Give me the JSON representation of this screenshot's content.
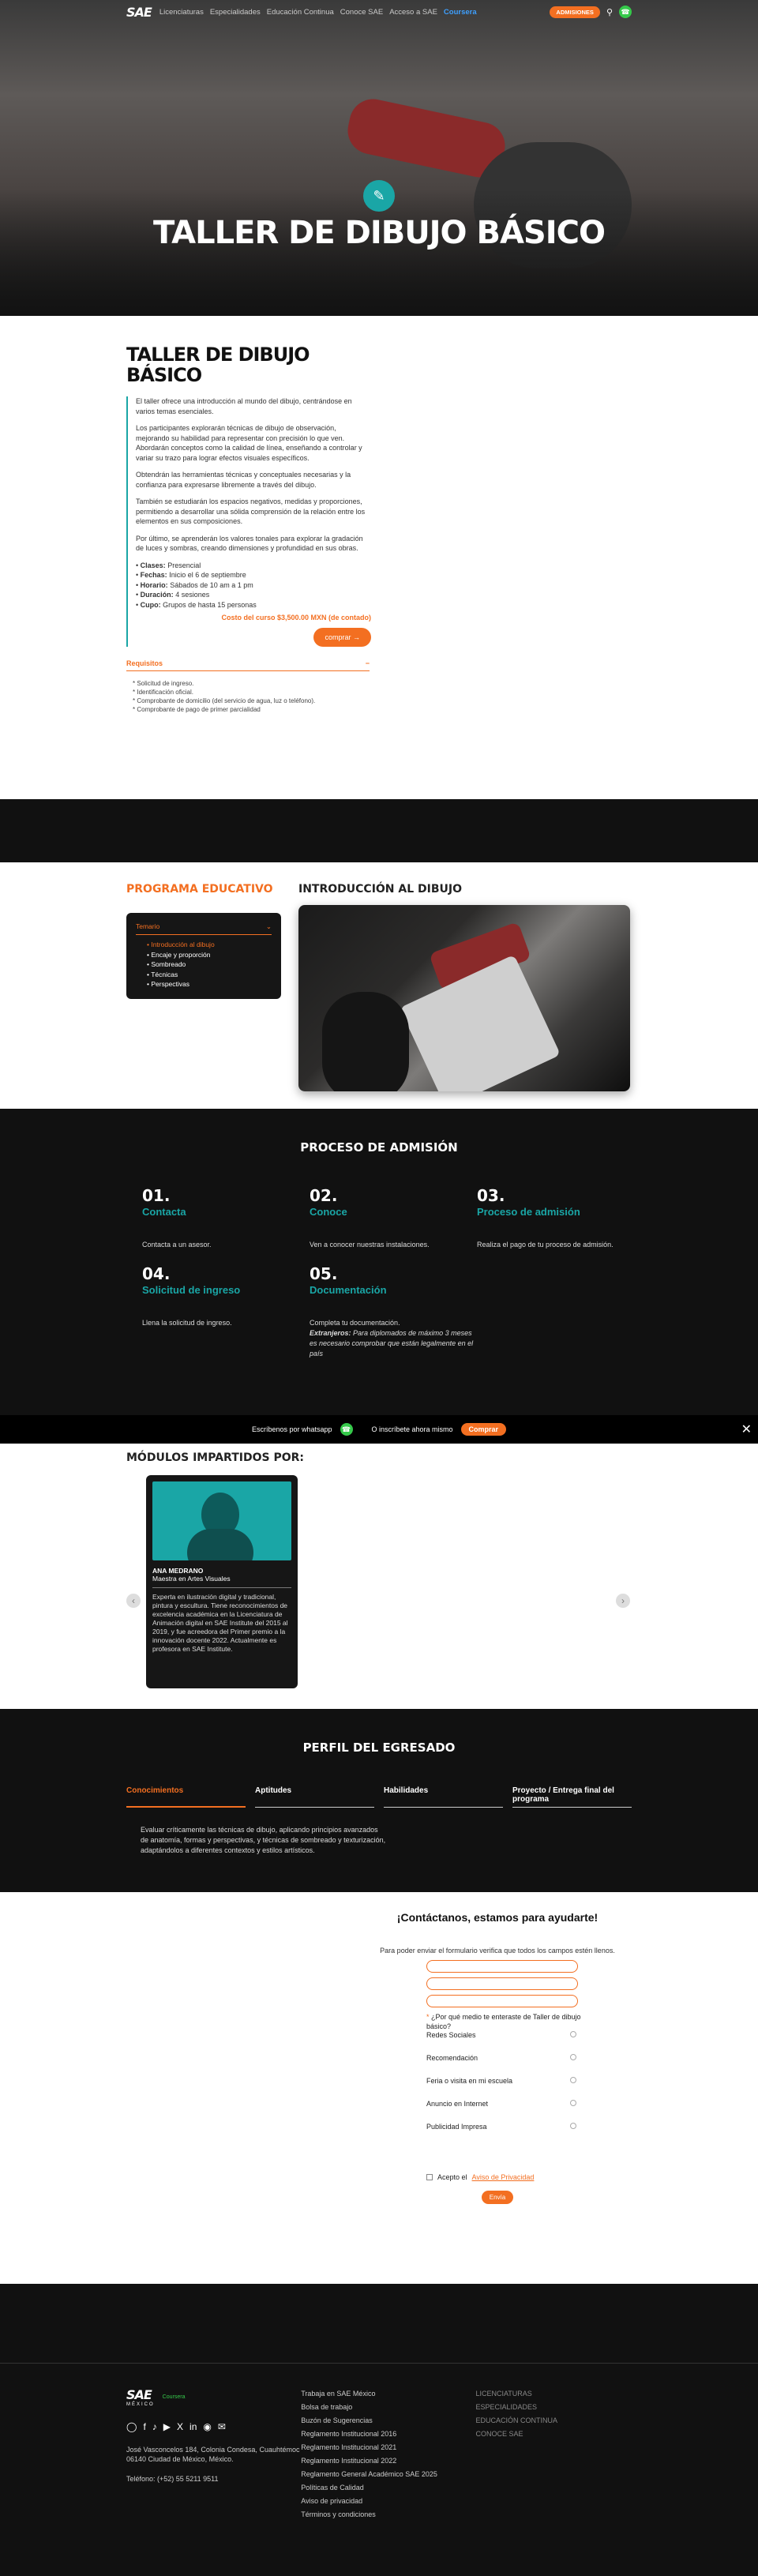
{
  "header": {
    "logo": "SAE",
    "nav": [
      "Licenciaturas",
      "Especialidades",
      "Educación Continua",
      "Conoce SAE",
      "Acceso a SAE"
    ],
    "nav_highlight": "Coursera",
    "cta": "ADMISIONES",
    "search_icon": "search-icon",
    "whatsapp_icon": "whatsapp-icon"
  },
  "hero": {
    "title": "TALLER DE DIBUJO BÁSICO",
    "badge_icon": "pen-nib-icon"
  },
  "intro": {
    "title": "TALLER DE DIBUJO BÁSICO",
    "paragraphs": [
      "El taller ofrece una introducción al mundo del dibujo, centrándose en varios temas esenciales.",
      "Los participantes explorarán técnicas de dibujo de observación, mejorando su habilidad para representar con precisión lo que ven. Abordarán conceptos como la calidad de línea, enseñando a controlar y variar su trazo para lograr efectos visuales específicos.",
      "Obtendrán las herramientas técnicas y conceptuales necesarias y la confianza para expresarse libremente a través del dibujo.",
      "También se estudiarán los espacios negativos, medidas y proporciones, permitiendo a desarrollar una sólida comprensión de la relación entre los elementos en sus composiciones.",
      "Por último, se aprenderán los valores tonales para explorar la gradación de luces y sombras, creando dimensiones y profundidad en sus obras."
    ],
    "details": [
      {
        "k": "Clases:",
        "v": "Presencial"
      },
      {
        "k": "Fechas:",
        "v": "Inicio el 6 de septiembre"
      },
      {
        "k": "Horario:",
        "v": "Sábados de 10 am a 1 pm"
      },
      {
        "k": "Duración:",
        "v": "4 sesiones"
      },
      {
        "k": "Cupo:",
        "v": "Grupos de hasta 15 personas"
      }
    ],
    "cost": "Costo del curso $3,500.00 MXN (de contado)",
    "buy": "comprar",
    "req_title": "Requisitos",
    "requirements": [
      "Solicitud de ingreso.",
      "Identificación oficial.",
      "Comprobante de domicilio (del servicio de agua, luz o teléfono).",
      "Comprobante de pago de primer parcialidad"
    ]
  },
  "program": {
    "title": "PROGRAMA EDUCATIVO",
    "temario": "Temario",
    "items": [
      "Introducción al dibujo",
      "Encaje y proporción",
      "Sombreado",
      "Técnicas",
      "Perspectivas"
    ],
    "video_title": "INTRODUCCIÓN AL DIBUJO"
  },
  "admision": {
    "title": "PROCESO DE ADMISIÓN",
    "steps": [
      {
        "num": "01.",
        "name": "Contacta",
        "desc": "Contacta a un asesor."
      },
      {
        "num": "02.",
        "name": "Conoce",
        "desc": "Ven a conocer nuestras instalaciones."
      },
      {
        "num": "03.",
        "name": "Proceso de admisión",
        "desc": "Realiza el pago de tu proceso de admisión."
      },
      {
        "num": "04.",
        "name": "Solicitud de ingreso",
        "desc": "Llena la solicitud de ingreso."
      },
      {
        "num": "05.",
        "name": "Documentación",
        "desc": "Completa tu documentación.",
        "note_label": "Extranjeros:",
        "note": "Para diplomados de máximo 3 meses es necesario comprobar que están legalmente en el país"
      }
    ]
  },
  "banner": {
    "whatsapp": "Escríbenos por whatsapp",
    "enroll": "O inscríbete ahora mismo",
    "enroll_button": "Comprar"
  },
  "modulos": {
    "title": "MÓDULOS IMPARTIDOS POR:",
    "teacher": {
      "name": "ANA MEDRANO",
      "role": "Maestra en Artes Visuales",
      "bio": "Experta en ilustración digital y tradicional, pintura y escultura. Tiene reconocimientos de excelencia académica en la Licenciatura de Animación digital en SAE Institute del 2015 al 2019, y fue acreedora del Primer premio a la innovación docente 2022. Actualmente es profesora en SAE Institute."
    }
  },
  "perfil": {
    "title": "PERFIL DEL EGRESADO",
    "tabs": [
      "Conocimientos",
      "Aptitudes",
      "Habilidades",
      "Proyecto / Entrega final del programa"
    ],
    "text": "Evaluar críticamente las técnicas de dibujo, aplicando principios avanzados de anatomía, formas y perspectivas, y técnicas de sombreado y texturización, adaptándolos a diferentes contextos y estilos artísticos."
  },
  "contact": {
    "title": "¡Contáctanos, estamos para ayudarte!",
    "sub": "Para poder enviar el formulario verifica que todos los campos estén llenos.",
    "question": "¿Por qué medio te enteraste de Taller de dibujo básico?",
    "options": [
      "Redes Sociales",
      "Recomendación",
      "Feria o visita en mi escuela",
      "Anuncio en Internet",
      "Publicidad Impresa"
    ],
    "privacy_text": "Acepto el",
    "privacy_link": "Aviso de Privacidad",
    "send": "Envía"
  },
  "footer": {
    "logo": "SAE",
    "logo_sub": "MÉXICO",
    "partner": "Coursera",
    "address": "José Vasconcelos 184, Colonia Condesa, Cuauhtémoc 06140 Ciudad de México, México.",
    "phone": "Teléfono: (+52) 55 5211 9511",
    "links": [
      "Trabaja en SAE México",
      "Bolsa de trabajo",
      "Buzón de Sugerencias",
      "Reglamento Institucional 2016",
      "Reglamento Institucional 2021",
      "Reglamento Institucional 2022",
      "Reglamento General Académico SAE 2025",
      "Políticas de Calidad",
      "Aviso de privacidad",
      "Términos y condiciones"
    ],
    "programs": [
      "LICENCIATURAS",
      "ESPECIALIDADES",
      "EDUCACIÓN CONTINUA",
      "CONOCE SAE"
    ]
  }
}
